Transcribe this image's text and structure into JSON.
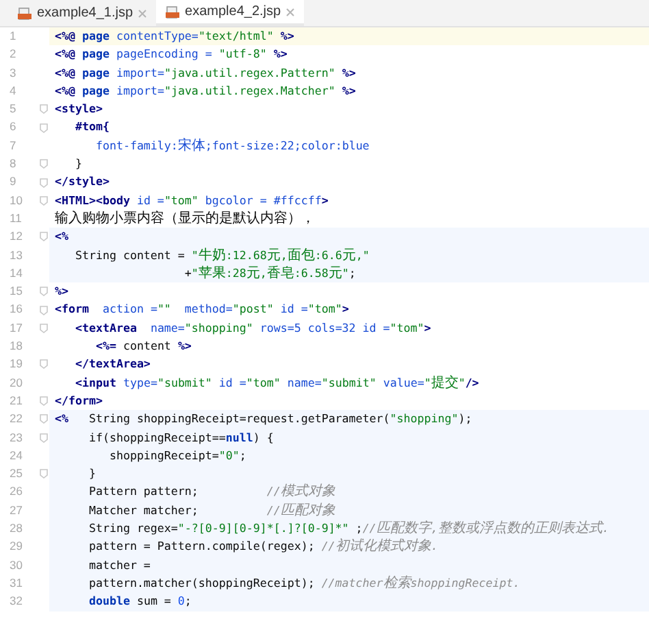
{
  "tabs": [
    {
      "label": "example4_1.jsp",
      "selected": false
    },
    {
      "label": "example4_2.jsp",
      "selected": true
    }
  ],
  "lines": [
    {
      "number": "1",
      "current_line": true,
      "scriptlet": false,
      "fold_marker": false,
      "tokens": [
        {
          "kind": "tag",
          "text": "<%@"
        },
        {
          "kind": "keyword",
          "text": " page "
        },
        {
          "kind": "attr",
          "text": "contentType="
        },
        {
          "kind": "string",
          "text": "\"text/html\""
        },
        {
          "kind": "tag",
          "text": " %>"
        }
      ]
    },
    {
      "number": "2",
      "current_line": false,
      "scriptlet": false,
      "fold_marker": false,
      "tokens": [
        {
          "kind": "tag",
          "text": "<%@"
        },
        {
          "kind": "keyword",
          "text": " page "
        },
        {
          "kind": "attr",
          "text": "pageEncoding = "
        },
        {
          "kind": "string",
          "text": "\"utf-8\""
        },
        {
          "kind": "tag",
          "text": " %>"
        }
      ]
    },
    {
      "number": "3",
      "current_line": false,
      "scriptlet": false,
      "fold_marker": false,
      "tokens": [
        {
          "kind": "tag",
          "text": "<%@"
        },
        {
          "kind": "keyword",
          "text": " page "
        },
        {
          "kind": "attr",
          "text": "import="
        },
        {
          "kind": "string",
          "text": "\"java.util.regex.Pattern\""
        },
        {
          "kind": "tag",
          "text": " %>"
        }
      ]
    },
    {
      "number": "4",
      "current_line": false,
      "scriptlet": false,
      "fold_marker": false,
      "tokens": [
        {
          "kind": "tag",
          "text": "<%@"
        },
        {
          "kind": "keyword",
          "text": " page "
        },
        {
          "kind": "attr",
          "text": "import="
        },
        {
          "kind": "string",
          "text": "\"java.util.regex.Matcher\""
        },
        {
          "kind": "tag",
          "text": " %>"
        }
      ]
    },
    {
      "number": "5",
      "current_line": false,
      "scriptlet": false,
      "fold_marker": true,
      "tokens": [
        {
          "kind": "tag",
          "text": "<style>"
        }
      ]
    },
    {
      "number": "6",
      "current_line": false,
      "scriptlet": false,
      "fold_marker": true,
      "tokens": [
        {
          "kind": "tag",
          "text": "   #tom{"
        }
      ]
    },
    {
      "number": "7",
      "current_line": false,
      "scriptlet": false,
      "fold_marker": false,
      "tokens": [
        {
          "kind": "attr",
          "text": "      font-family:宋体;font-size:22;color:blue"
        }
      ]
    },
    {
      "number": "8",
      "current_line": false,
      "scriptlet": false,
      "fold_marker": true,
      "tokens": [
        {
          "kind": "plain",
          "text": "   }"
        }
      ]
    },
    {
      "number": "9",
      "current_line": false,
      "scriptlet": false,
      "fold_marker": true,
      "tokens": [
        {
          "kind": "tag",
          "text": "</style>"
        }
      ]
    },
    {
      "number": "10",
      "current_line": false,
      "scriptlet": false,
      "fold_marker": true,
      "tokens": [
        {
          "kind": "tag",
          "text": "<HTML><body"
        },
        {
          "kind": "attr",
          "text": " id ="
        },
        {
          "kind": "string",
          "text": "\"tom\""
        },
        {
          "kind": "attr",
          "text": " bgcolor = #ffccff"
        },
        {
          "kind": "tag",
          "text": ">"
        }
      ]
    },
    {
      "number": "11",
      "current_line": false,
      "scriptlet": false,
      "fold_marker": false,
      "tokens": [
        {
          "kind": "plain",
          "text": "输入购物小票内容（显示的是默认内容），"
        }
      ]
    },
    {
      "number": "12",
      "current_line": false,
      "scriptlet": true,
      "fold_marker": true,
      "tokens": [
        {
          "kind": "tag",
          "text": "<%"
        }
      ]
    },
    {
      "number": "13",
      "current_line": false,
      "scriptlet": true,
      "fold_marker": false,
      "tokens": [
        {
          "kind": "plain",
          "text": "   String content = "
        },
        {
          "kind": "string",
          "text": "\"牛奶:12.68元,面包:6.6元,\""
        }
      ]
    },
    {
      "number": "14",
      "current_line": false,
      "scriptlet": true,
      "fold_marker": false,
      "tokens": [
        {
          "kind": "plain",
          "text": "                   +"
        },
        {
          "kind": "string",
          "text": "\"苹果:28元,香皂:6.58元\""
        },
        {
          "kind": "plain",
          "text": ";"
        }
      ]
    },
    {
      "number": "15",
      "current_line": false,
      "scriptlet": false,
      "fold_marker": true,
      "tokens": [
        {
          "kind": "tag",
          "text": "%>"
        }
      ]
    },
    {
      "number": "16",
      "current_line": false,
      "scriptlet": false,
      "fold_marker": true,
      "tokens": [
        {
          "kind": "tag",
          "text": "<form"
        },
        {
          "kind": "attr",
          "text": "  action ="
        },
        {
          "kind": "string",
          "text": "\"\""
        },
        {
          "kind": "attr",
          "text": "  method="
        },
        {
          "kind": "string",
          "text": "\"post\""
        },
        {
          "kind": "attr",
          "text": " id ="
        },
        {
          "kind": "string",
          "text": "\"tom\""
        },
        {
          "kind": "tag",
          "text": ">"
        }
      ]
    },
    {
      "number": "17",
      "current_line": false,
      "scriptlet": false,
      "fold_marker": true,
      "tokens": [
        {
          "kind": "tag",
          "text": "   <textArea"
        },
        {
          "kind": "attr",
          "text": "  name="
        },
        {
          "kind": "string",
          "text": "\"shopping\""
        },
        {
          "kind": "attr",
          "text": " rows=5 cols=32 id ="
        },
        {
          "kind": "string",
          "text": "\"tom\""
        },
        {
          "kind": "tag",
          "text": ">"
        }
      ]
    },
    {
      "number": "18",
      "current_line": false,
      "scriptlet": false,
      "fold_marker": false,
      "tokens": [
        {
          "kind": "tag",
          "text": "      <%="
        },
        {
          "kind": "plain",
          "text": " content "
        },
        {
          "kind": "tag",
          "text": "%>"
        }
      ]
    },
    {
      "number": "19",
      "current_line": false,
      "scriptlet": false,
      "fold_marker": true,
      "tokens": [
        {
          "kind": "tag",
          "text": "   </textArea>"
        }
      ]
    },
    {
      "number": "20",
      "current_line": false,
      "scriptlet": false,
      "fold_marker": false,
      "tokens": [
        {
          "kind": "tag",
          "text": "   <input"
        },
        {
          "kind": "attr",
          "text": " type="
        },
        {
          "kind": "string",
          "text": "\"submit\""
        },
        {
          "kind": "attr",
          "text": " id ="
        },
        {
          "kind": "string",
          "text": "\"tom\""
        },
        {
          "kind": "attr",
          "text": " name="
        },
        {
          "kind": "string",
          "text": "\"submit\""
        },
        {
          "kind": "attr",
          "text": " value="
        },
        {
          "kind": "string",
          "text": "\"提交\""
        },
        {
          "kind": "tag",
          "text": "/>"
        }
      ]
    },
    {
      "number": "21",
      "current_line": false,
      "scriptlet": false,
      "fold_marker": true,
      "tokens": [
        {
          "kind": "tag",
          "text": "</form>"
        }
      ]
    },
    {
      "number": "22",
      "current_line": false,
      "scriptlet": true,
      "fold_marker": true,
      "tokens": [
        {
          "kind": "tag",
          "text": "<%"
        },
        {
          "kind": "plain",
          "text": "   String shoppingReceipt=request.getParameter("
        },
        {
          "kind": "string",
          "text": "\"shopping\""
        },
        {
          "kind": "plain",
          "text": ");"
        }
      ]
    },
    {
      "number": "23",
      "current_line": false,
      "scriptlet": true,
      "fold_marker": true,
      "tokens": [
        {
          "kind": "plain",
          "text": "     if(shoppingReceipt=="
        },
        {
          "kind": "keyword",
          "text": "null"
        },
        {
          "kind": "plain",
          "text": ") {"
        }
      ]
    },
    {
      "number": "24",
      "current_line": false,
      "scriptlet": true,
      "fold_marker": false,
      "tokens": [
        {
          "kind": "plain",
          "text": "        shoppingReceipt="
        },
        {
          "kind": "string",
          "text": "\"0\""
        },
        {
          "kind": "plain",
          "text": ";"
        }
      ]
    },
    {
      "number": "25",
      "current_line": false,
      "scriptlet": true,
      "fold_marker": true,
      "tokens": [
        {
          "kind": "plain",
          "text": "     }"
        }
      ]
    },
    {
      "number": "26",
      "current_line": false,
      "scriptlet": true,
      "fold_marker": false,
      "tokens": [
        {
          "kind": "plain",
          "text": "     Pattern pattern;          "
        },
        {
          "kind": "comment",
          "text": "//模式对象"
        }
      ]
    },
    {
      "number": "27",
      "current_line": false,
      "scriptlet": true,
      "fold_marker": false,
      "tokens": [
        {
          "kind": "plain",
          "text": "     Matcher matcher;          "
        },
        {
          "kind": "comment",
          "text": "//匹配对象"
        }
      ]
    },
    {
      "number": "28",
      "current_line": false,
      "scriptlet": true,
      "fold_marker": false,
      "tokens": [
        {
          "kind": "plain",
          "text": "     String regex="
        },
        {
          "kind": "string",
          "text": "\"-?[0-9][0-9]*[.]?[0-9]*\""
        },
        {
          "kind": "plain",
          "text": " ;"
        },
        {
          "kind": "comment",
          "text": "//匹配数字,整数或浮点数的正则表达式."
        }
      ]
    },
    {
      "number": "29",
      "current_line": false,
      "scriptlet": true,
      "fold_marker": false,
      "tokens": [
        {
          "kind": "plain",
          "text": "     pattern = Pattern.compile(regex); "
        },
        {
          "kind": "comment",
          "text": "//初试化模式对象."
        }
      ]
    },
    {
      "number": "30",
      "current_line": false,
      "scriptlet": true,
      "fold_marker": false,
      "tokens": [
        {
          "kind": "plain",
          "text": "     matcher ="
        }
      ]
    },
    {
      "number": "31",
      "current_line": false,
      "scriptlet": true,
      "fold_marker": false,
      "tokens": [
        {
          "kind": "plain",
          "text": "     pattern.matcher(shoppingReceipt); "
        },
        {
          "kind": "comment",
          "text": "//matcher检索shoppingReceipt."
        }
      ]
    },
    {
      "number": "32",
      "current_line": false,
      "scriptlet": true,
      "fold_marker": false,
      "tokens": [
        {
          "kind": "keyword",
          "text": "     double"
        },
        {
          "kind": "plain",
          "text": " sum = "
        },
        {
          "kind": "number",
          "text": "0"
        },
        {
          "kind": "plain",
          "text": ";"
        }
      ]
    }
  ]
}
